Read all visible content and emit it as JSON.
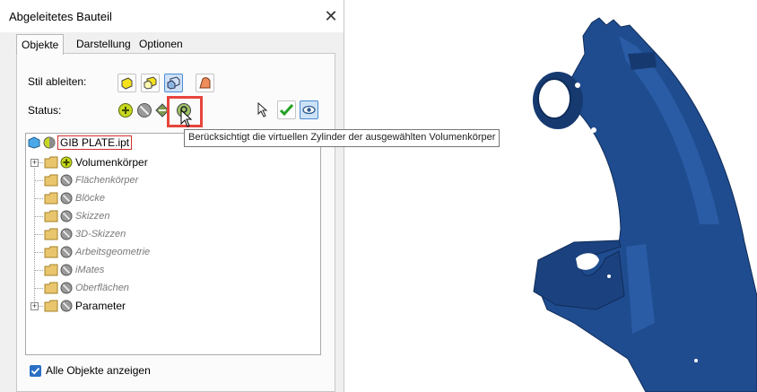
{
  "dialog": {
    "title": "Abgeleitetes Bauteil",
    "close_glyph": "✕",
    "tabs": [
      {
        "label": "Objekte",
        "active": true
      },
      {
        "label": "Darstellung",
        "active": false
      },
      {
        "label": "Optionen",
        "active": false
      }
    ],
    "style_label": "Stil ableiten:",
    "status_label": "Status:",
    "style_buttons": [
      "derive-solid-icon",
      "derive-surface-icon",
      "derive-composite-icon",
      "derive-body-icon"
    ],
    "status_buttons": [
      "include-icon",
      "exclude-icon",
      "subtract-icon",
      "virtual-cylinder-icon"
    ],
    "right_buttons": [
      "select-arrow-icon",
      "check-icon",
      "eye-icon"
    ],
    "tooltip": "Berücksichtigt die virtuellen Zylinder der ausgewählten Volumenkörper",
    "tree": {
      "root": "GIB PLATE.ipt",
      "items": [
        {
          "label": "Volumenkörper",
          "state": "include",
          "expandable": true,
          "dim": false
        },
        {
          "label": "Flächenkörper",
          "state": "exclude",
          "expandable": false,
          "dim": true
        },
        {
          "label": "Blöcke",
          "state": "exclude",
          "expandable": false,
          "dim": true
        },
        {
          "label": "Skizzen",
          "state": "exclude",
          "expandable": false,
          "dim": true
        },
        {
          "label": "3D-Skizzen",
          "state": "exclude",
          "expandable": false,
          "dim": true
        },
        {
          "label": "Arbeitsgeometrie",
          "state": "exclude",
          "expandable": false,
          "dim": true
        },
        {
          "label": "iMates",
          "state": "exclude",
          "expandable": false,
          "dim": true
        },
        {
          "label": "Oberflächen",
          "state": "exclude",
          "expandable": false,
          "dim": true
        },
        {
          "label": "Parameter",
          "state": "exclude",
          "expandable": true,
          "dim": false
        }
      ]
    },
    "show_all_label": "Alle Objekte anzeigen",
    "show_all_checked": true
  },
  "colors": {
    "accent": "#2b6fc4",
    "highlight": "#e8443c",
    "model": "#1f4c8f",
    "include_green": "#c8d820",
    "exclude_gray": "#8c8c8c",
    "folder": "#e9c56d"
  }
}
